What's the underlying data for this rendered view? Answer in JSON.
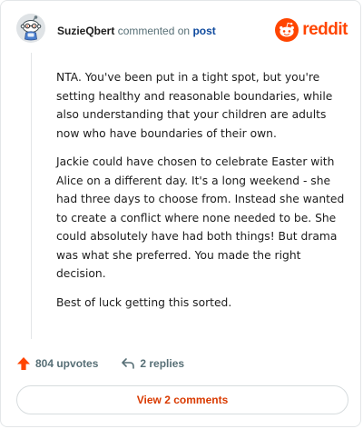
{
  "comment": {
    "username": "SuzieQbert",
    "action_text": "commented on",
    "post_link": "post",
    "paragraphs": [
      "NTA. You've been put in a tight spot, but you're setting healthy and reasonable boundaries, while also understanding that your children are adults now who have boundaries of their own.",
      "Jackie could have chosen to celebrate Easter with Alice on a different day. It's a long weekend - she had three days to choose from. Instead she wanted to create a conflict where none needed to be. She could absolutely have had both things! But drama was what she preferred. You made the right decision.",
      "Best of luck getting this sorted."
    ],
    "upvotes_label": "804 upvotes",
    "replies_label": "2 replies",
    "view_comments_label": "View 2 comments"
  },
  "brand": {
    "name": "reddit",
    "color": "#ff4500"
  },
  "colors": {
    "upvote": "#ff4500",
    "link": "#0f4a9e",
    "view_button_text": "#d93a00",
    "muted": "#576f76"
  },
  "icons": {
    "avatar": "snoo-avatar",
    "brand": "reddit-logo-icon",
    "upvote": "upvote-arrow-icon",
    "reply": "reply-arrow-icon"
  }
}
